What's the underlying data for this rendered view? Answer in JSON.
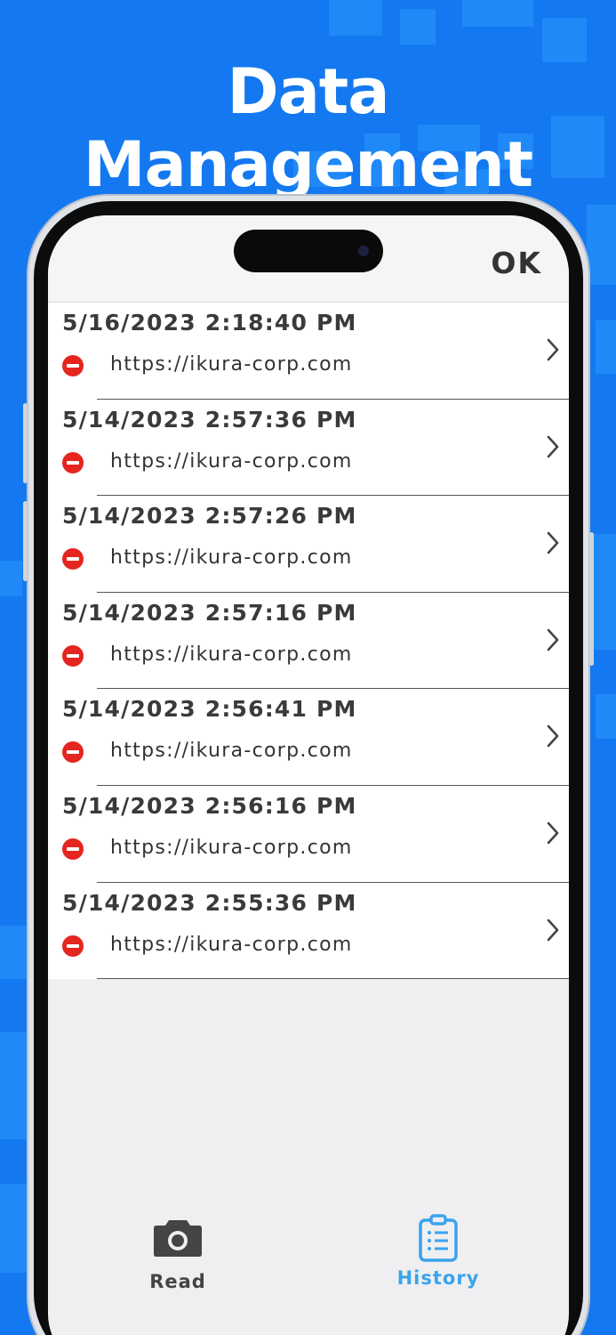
{
  "headline": "Data Management",
  "colors": {
    "background": "#1479f0",
    "accent": "#3aa3ee",
    "error": "#e5251f"
  },
  "header": {
    "ok_label": "OK"
  },
  "history": [
    {
      "date": "5/16/2023 2:18:40 PM",
      "url": "https://ikura-corp.com",
      "status_icon": "no-entry-icon"
    },
    {
      "date": "5/14/2023 2:57:36 PM",
      "url": "https://ikura-corp.com",
      "status_icon": "no-entry-icon"
    },
    {
      "date": "5/14/2023 2:57:26 PM",
      "url": "https://ikura-corp.com",
      "status_icon": "no-entry-icon"
    },
    {
      "date": "5/14/2023 2:57:16 PM",
      "url": "https://ikura-corp.com",
      "status_icon": "no-entry-icon"
    },
    {
      "date": "5/14/2023 2:56:41 PM",
      "url": "https://ikura-corp.com",
      "status_icon": "no-entry-icon"
    },
    {
      "date": "5/14/2023 2:56:16 PM",
      "url": "https://ikura-corp.com",
      "status_icon": "no-entry-icon"
    },
    {
      "date": "5/14/2023 2:55:36 PM",
      "url": "https://ikura-corp.com",
      "status_icon": "no-entry-icon"
    }
  ],
  "tabs": [
    {
      "label": "Read",
      "icon": "camera-icon",
      "selected": false
    },
    {
      "label": "History",
      "icon": "clipboard-list-icon",
      "selected": true
    }
  ]
}
